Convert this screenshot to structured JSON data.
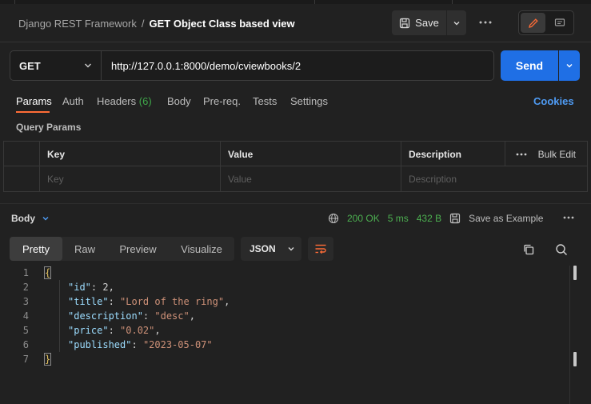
{
  "header": {
    "collection": "Django REST Framework",
    "separator": "/",
    "request_name": "GET Object Class based view",
    "save_label": "Save",
    "more_icon": "ellipsis-icon",
    "edit_icon": "pencil-icon",
    "doc_icon": "comment-icon"
  },
  "request": {
    "method": "GET",
    "url": "http://127.0.0.1:8000/demo/cviewbooks/2",
    "send_label": "Send"
  },
  "tabs": [
    {
      "label": "Params"
    },
    {
      "label": "Auth"
    },
    {
      "label": "Headers",
      "count": "(6)"
    },
    {
      "label": "Body"
    },
    {
      "label": "Pre-req."
    },
    {
      "label": "Tests"
    },
    {
      "label": "Settings"
    }
  ],
  "cookies_label": "Cookies",
  "query_params": {
    "title": "Query Params",
    "columns": [
      "Key",
      "Value",
      "Description"
    ],
    "placeholders": [
      "Key",
      "Value",
      "Description"
    ],
    "bulk_edit_label": "Bulk Edit"
  },
  "response": {
    "body_label": "Body",
    "status": "200 OK",
    "time": "5 ms",
    "size": "432 B",
    "save_example_label": "Save as Example",
    "view_tabs": [
      "Pretty",
      "Raw",
      "Preview",
      "Visualize"
    ],
    "format": "JSON",
    "code_lines": [
      {
        "num": "1",
        "text": "{"
      },
      {
        "num": "2",
        "key": "\"id\"",
        "value": "2",
        "value_type": "number",
        "trail": ","
      },
      {
        "num": "3",
        "key": "\"title\"",
        "value": "\"Lord of the ring\"",
        "value_type": "string",
        "trail": ","
      },
      {
        "num": "4",
        "key": "\"description\"",
        "value": "\"desc\"",
        "value_type": "string",
        "trail": ","
      },
      {
        "num": "5",
        "key": "\"price\"",
        "value": "\"0.02\"",
        "value_type": "string",
        "trail": ","
      },
      {
        "num": "6",
        "key": "\"published\"",
        "value": "\"2023-05-07\"",
        "value_type": "string",
        "trail": ""
      },
      {
        "num": "7",
        "text": "}"
      }
    ]
  },
  "colors": {
    "accent_orange": "#ff6c37",
    "send_blue": "#1f6fe5",
    "status_green": "#4caf50",
    "link_blue": "#4f9cf5"
  }
}
